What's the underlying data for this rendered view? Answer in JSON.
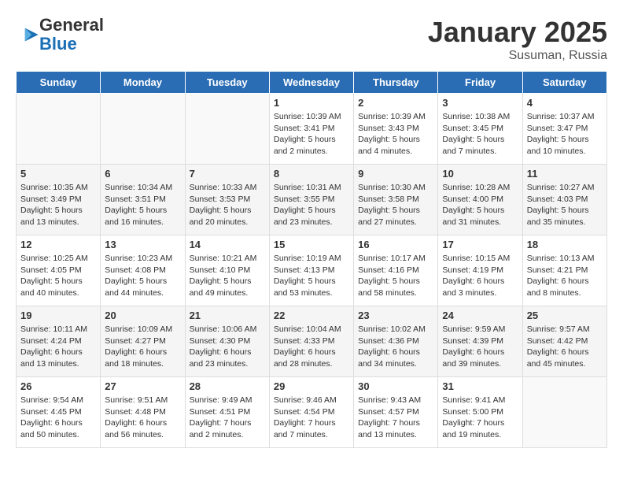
{
  "logo": {
    "general": "General",
    "blue": "Blue"
  },
  "title": "January 2025",
  "subtitle": "Susuman, Russia",
  "weekdays": [
    "Sunday",
    "Monday",
    "Tuesday",
    "Wednesday",
    "Thursday",
    "Friday",
    "Saturday"
  ],
  "weeks": [
    [
      {
        "day": "",
        "info": ""
      },
      {
        "day": "",
        "info": ""
      },
      {
        "day": "",
        "info": ""
      },
      {
        "day": "1",
        "info": "Sunrise: 10:39 AM\nSunset: 3:41 PM\nDaylight: 5 hours\nand 2 minutes."
      },
      {
        "day": "2",
        "info": "Sunrise: 10:39 AM\nSunset: 3:43 PM\nDaylight: 5 hours\nand 4 minutes."
      },
      {
        "day": "3",
        "info": "Sunrise: 10:38 AM\nSunset: 3:45 PM\nDaylight: 5 hours\nand 7 minutes."
      },
      {
        "day": "4",
        "info": "Sunrise: 10:37 AM\nSunset: 3:47 PM\nDaylight: 5 hours\nand 10 minutes."
      }
    ],
    [
      {
        "day": "5",
        "info": "Sunrise: 10:35 AM\nSunset: 3:49 PM\nDaylight: 5 hours\nand 13 minutes."
      },
      {
        "day": "6",
        "info": "Sunrise: 10:34 AM\nSunset: 3:51 PM\nDaylight: 5 hours\nand 16 minutes."
      },
      {
        "day": "7",
        "info": "Sunrise: 10:33 AM\nSunset: 3:53 PM\nDaylight: 5 hours\nand 20 minutes."
      },
      {
        "day": "8",
        "info": "Sunrise: 10:31 AM\nSunset: 3:55 PM\nDaylight: 5 hours\nand 23 minutes."
      },
      {
        "day": "9",
        "info": "Sunrise: 10:30 AM\nSunset: 3:58 PM\nDaylight: 5 hours\nand 27 minutes."
      },
      {
        "day": "10",
        "info": "Sunrise: 10:28 AM\nSunset: 4:00 PM\nDaylight: 5 hours\nand 31 minutes."
      },
      {
        "day": "11",
        "info": "Sunrise: 10:27 AM\nSunset: 4:03 PM\nDaylight: 5 hours\nand 35 minutes."
      }
    ],
    [
      {
        "day": "12",
        "info": "Sunrise: 10:25 AM\nSunset: 4:05 PM\nDaylight: 5 hours\nand 40 minutes."
      },
      {
        "day": "13",
        "info": "Sunrise: 10:23 AM\nSunset: 4:08 PM\nDaylight: 5 hours\nand 44 minutes."
      },
      {
        "day": "14",
        "info": "Sunrise: 10:21 AM\nSunset: 4:10 PM\nDaylight: 5 hours\nand 49 minutes."
      },
      {
        "day": "15",
        "info": "Sunrise: 10:19 AM\nSunset: 4:13 PM\nDaylight: 5 hours\nand 53 minutes."
      },
      {
        "day": "16",
        "info": "Sunrise: 10:17 AM\nSunset: 4:16 PM\nDaylight: 5 hours\nand 58 minutes."
      },
      {
        "day": "17",
        "info": "Sunrise: 10:15 AM\nSunset: 4:19 PM\nDaylight: 6 hours\nand 3 minutes."
      },
      {
        "day": "18",
        "info": "Sunrise: 10:13 AM\nSunset: 4:21 PM\nDaylight: 6 hours\nand 8 minutes."
      }
    ],
    [
      {
        "day": "19",
        "info": "Sunrise: 10:11 AM\nSunset: 4:24 PM\nDaylight: 6 hours\nand 13 minutes."
      },
      {
        "day": "20",
        "info": "Sunrise: 10:09 AM\nSunset: 4:27 PM\nDaylight: 6 hours\nand 18 minutes."
      },
      {
        "day": "21",
        "info": "Sunrise: 10:06 AM\nSunset: 4:30 PM\nDaylight: 6 hours\nand 23 minutes."
      },
      {
        "day": "22",
        "info": "Sunrise: 10:04 AM\nSunset: 4:33 PM\nDaylight: 6 hours\nand 28 minutes."
      },
      {
        "day": "23",
        "info": "Sunrise: 10:02 AM\nSunset: 4:36 PM\nDaylight: 6 hours\nand 34 minutes."
      },
      {
        "day": "24",
        "info": "Sunrise: 9:59 AM\nSunset: 4:39 PM\nDaylight: 6 hours\nand 39 minutes."
      },
      {
        "day": "25",
        "info": "Sunrise: 9:57 AM\nSunset: 4:42 PM\nDaylight: 6 hours\nand 45 minutes."
      }
    ],
    [
      {
        "day": "26",
        "info": "Sunrise: 9:54 AM\nSunset: 4:45 PM\nDaylight: 6 hours\nand 50 minutes."
      },
      {
        "day": "27",
        "info": "Sunrise: 9:51 AM\nSunset: 4:48 PM\nDaylight: 6 hours\nand 56 minutes."
      },
      {
        "day": "28",
        "info": "Sunrise: 9:49 AM\nSunset: 4:51 PM\nDaylight: 7 hours\nand 2 minutes."
      },
      {
        "day": "29",
        "info": "Sunrise: 9:46 AM\nSunset: 4:54 PM\nDaylight: 7 hours\nand 7 minutes."
      },
      {
        "day": "30",
        "info": "Sunrise: 9:43 AM\nSunset: 4:57 PM\nDaylight: 7 hours\nand 13 minutes."
      },
      {
        "day": "31",
        "info": "Sunrise: 9:41 AM\nSunset: 5:00 PM\nDaylight: 7 hours\nand 19 minutes."
      },
      {
        "day": "",
        "info": ""
      }
    ]
  ]
}
